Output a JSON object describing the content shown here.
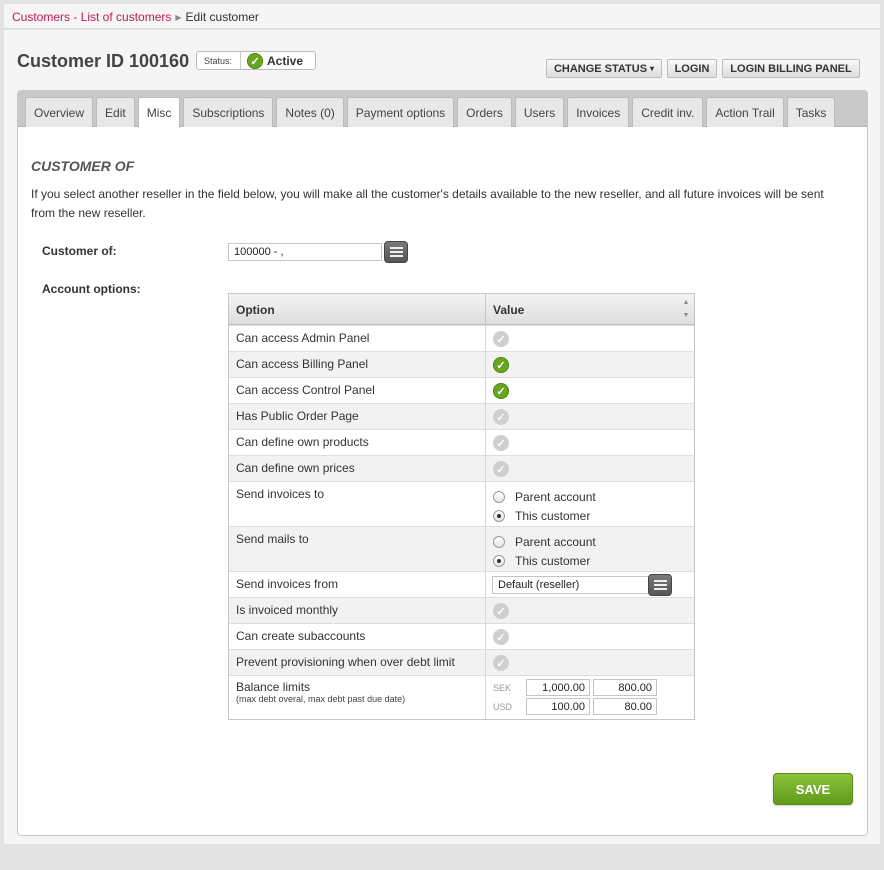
{
  "breadcrumb": {
    "link": "Customers - List of customers",
    "current": "Edit customer"
  },
  "header": {
    "title": "Customer ID 100160",
    "status_label": "Status:",
    "status_value": "Active",
    "buttons": {
      "change_status": "CHANGE STATUS",
      "login": "LOGIN",
      "login_billing": "LOGIN BILLING PANEL"
    }
  },
  "tabs": [
    "Overview",
    "Edit",
    "Misc",
    "Subscriptions",
    "Notes (0)",
    "Payment options",
    "Orders",
    "Users",
    "Invoices",
    "Credit inv.",
    "Action Trail",
    "Tasks"
  ],
  "active_tab": "Misc",
  "section": {
    "title": "CUSTOMER OF",
    "description": "If you select another reseller in the field below, you will make all the customer's details available to the new reseller, and all future invoices will be sent from the new reseller."
  },
  "form": {
    "customer_of_label": "Customer of:",
    "customer_of_value": "100000 - ,",
    "account_options_label": "Account options:"
  },
  "table": {
    "col_option": "Option",
    "col_value": "Value",
    "rows": [
      {
        "label": "Can access Admin Panel",
        "checked": false
      },
      {
        "label": "Can access Billing Panel",
        "checked": true
      },
      {
        "label": "Can access Control Panel",
        "checked": true
      },
      {
        "label": "Has Public Order Page",
        "checked": false
      },
      {
        "label": "Can define own products",
        "checked": false
      },
      {
        "label": "Can define own prices",
        "checked": false
      }
    ],
    "send_invoices_to": {
      "label": "Send invoices to",
      "opt1": "Parent account",
      "opt2": "This customer",
      "selected": "This customer"
    },
    "send_mails_to": {
      "label": "Send mails to",
      "opt1": "Parent account",
      "opt2": "This customer",
      "selected": "This customer"
    },
    "send_invoices_from": {
      "label": "Send invoices from",
      "value": "Default (reseller)"
    },
    "rows2": [
      {
        "label": "Is invoiced monthly",
        "checked": false
      },
      {
        "label": "Can create subaccounts",
        "checked": false
      },
      {
        "label": "Prevent provisioning when over debt limit",
        "checked": false
      }
    ],
    "balance": {
      "label": "Balance limits",
      "note": "(max debt overal, max debt past due date)",
      "sek_label": "SEK",
      "sek_max": "1,000.00",
      "sek_past": "800.00",
      "usd_label": "USD",
      "usd_max": "100.00",
      "usd_past": "80.00"
    }
  },
  "save_label": "SAVE",
  "colors": {
    "link": "#c2185b",
    "accent_green": "#69a620"
  }
}
